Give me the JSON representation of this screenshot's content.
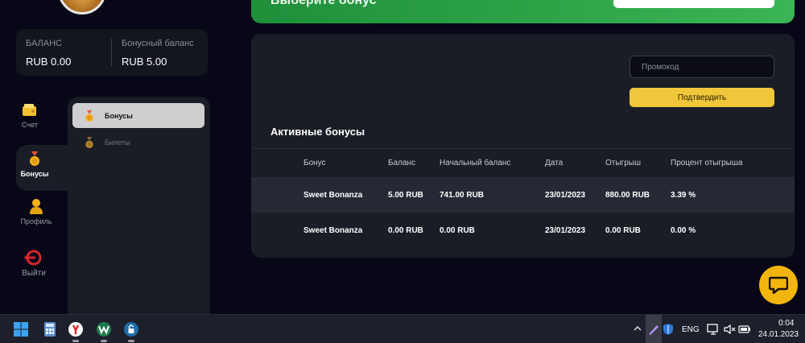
{
  "balance": {
    "label": "БАЛАНС",
    "value": "RUB 0.00",
    "bonus_label": "Бонусный баланс",
    "bonus_value": "RUB 5.00"
  },
  "nav": {
    "account": "Счет",
    "bonuses": "Бонусы",
    "profile": "Профиль",
    "logout": "Выйти"
  },
  "submenu": {
    "bonuses": "Бонусы",
    "tickets": "Билеты"
  },
  "banner": {
    "title": "Выберите бонус"
  },
  "promo": {
    "placeholder": "Промокод",
    "confirm_label": "Подтвердить"
  },
  "active_bonuses": {
    "title": "Активные бонусы",
    "columns": [
      "Бонус",
      "Баланс",
      "Начальный баланс",
      "Дата",
      "Отыгрыш",
      "Процент отыгрыша"
    ],
    "rows": [
      [
        "Sweet Bonanza",
        "5.00 RUB",
        "741.00 RUB",
        "23/01/2023",
        "880.00 RUB",
        "3.39 %"
      ],
      [
        "Sweet Bonanza",
        "0.00 RUB",
        "0.00 RUB",
        "23/01/2023",
        "0.00 RUB",
        "0.00 %"
      ]
    ]
  },
  "taskbar": {
    "language": "ENG",
    "time": "0:04",
    "date": "24.01.2023"
  },
  "colors": {
    "accent_yellow": "#f0c63a",
    "banner_green": "#2fa64a",
    "panel_bg": "#1b1d26",
    "page_bg": "#070718"
  }
}
